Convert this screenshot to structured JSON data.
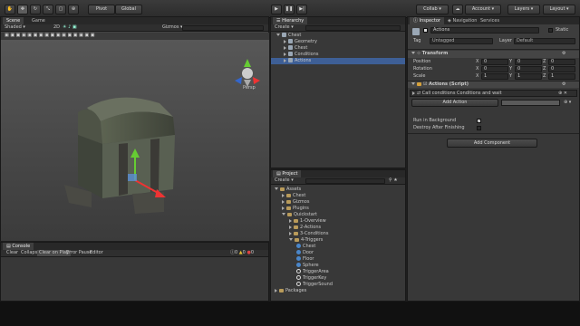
{
  "toolbar": {
    "pivot": "Pivot",
    "global": "Global",
    "collab": "Collab",
    "account": "Account",
    "layers": "Layers",
    "layout": "Layout"
  },
  "scene": {
    "tabs": [
      "Scene",
      "Game"
    ],
    "shading": "Shaded",
    "mode_2d": "2D",
    "gizmos": "Gizmos",
    "persp": "Persp"
  },
  "hierarchy": {
    "tab": "Hierarchy",
    "create": "Create",
    "items": [
      {
        "label": "Chest",
        "depth": 0
      },
      {
        "label": "Geometry",
        "depth": 1
      },
      {
        "label": "Chest",
        "depth": 1
      },
      {
        "label": "Conditions",
        "depth": 1
      },
      {
        "label": "Actions",
        "depth": 1
      }
    ]
  },
  "project": {
    "tab": "Project",
    "create": "Create",
    "items": [
      {
        "label": "Assets",
        "type": "folder",
        "depth": 0
      },
      {
        "label": "Chest",
        "type": "folder",
        "depth": 1
      },
      {
        "label": "Gizmos",
        "type": "folder",
        "depth": 1
      },
      {
        "label": "Plugins",
        "type": "folder",
        "depth": 1
      },
      {
        "label": "Quickstart",
        "type": "folder",
        "depth": 1
      },
      {
        "label": "1-Overview",
        "type": "folder",
        "depth": 2
      },
      {
        "label": "2-Actions",
        "type": "folder",
        "depth": 2
      },
      {
        "label": "3-Conditions",
        "type": "folder",
        "depth": 2
      },
      {
        "label": "4-Triggers",
        "type": "folder",
        "depth": 2
      },
      {
        "label": "Chest",
        "type": "ball",
        "depth": 3
      },
      {
        "label": "Door",
        "type": "ball",
        "depth": 3
      },
      {
        "label": "Floor",
        "type": "ball",
        "depth": 3
      },
      {
        "label": "Sphere",
        "type": "ball",
        "depth": 3
      },
      {
        "label": "TriggerArea",
        "type": "gear",
        "depth": 3
      },
      {
        "label": "TriggerKey",
        "type": "gear",
        "depth": 3
      },
      {
        "label": "TriggerSound",
        "type": "gear",
        "depth": 3
      },
      {
        "label": "Packages",
        "type": "folder",
        "depth": 0
      }
    ]
  },
  "inspector": {
    "tabs": [
      "Inspector",
      "Navigation",
      "Services"
    ],
    "object_name": "Actions",
    "static": "Static",
    "tag_label": "Tag",
    "tag_value": "Untagged",
    "layer_label": "Layer",
    "layer_value": "Default",
    "transform": {
      "title": "Transform",
      "rows": [
        {
          "label": "Position",
          "x": "0",
          "y": "0",
          "z": "0"
        },
        {
          "label": "Rotation",
          "x": "0",
          "y": "0",
          "z": "0"
        },
        {
          "label": "Scale",
          "x": "1",
          "y": "1",
          "z": "1"
        }
      ],
      "axis": [
        "X",
        "Y",
        "Z"
      ]
    },
    "actions_script": {
      "title": "Actions (Script)",
      "subtitle": "Call conditions Conditions and wait",
      "add_action": "Add Action",
      "run_in_background": "Run in Background",
      "destroy_after": "Destroy After Finishing"
    },
    "add_component": "Add Component"
  },
  "console": {
    "tab": "Console",
    "buttons": [
      "Clear",
      "Collapse",
      "Clear on Play",
      "Error Pause",
      "Editor"
    ],
    "counts": [
      "0",
      "0",
      "0"
    ]
  }
}
